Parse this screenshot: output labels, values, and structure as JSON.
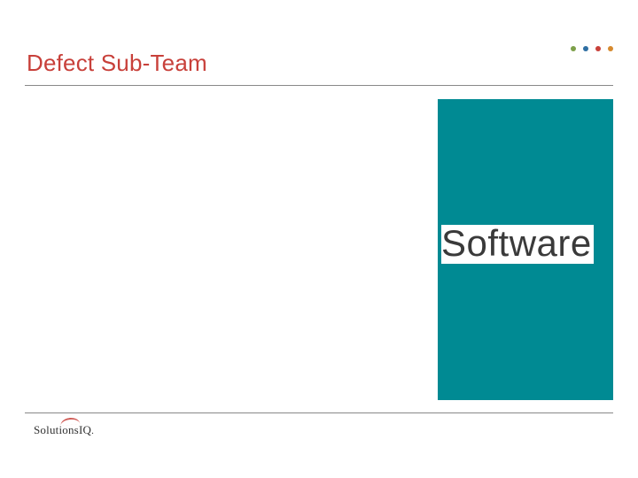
{
  "colors": {
    "title": "#c8403a",
    "teal": "#008a93",
    "dot1": "#7da04a",
    "dot2": "#2f6fa3",
    "dot3": "#c8403a",
    "dot4": "#d68a2f"
  },
  "header": {
    "title": "Defect Sub-Team"
  },
  "body": {
    "box_label": "Software"
  },
  "footer": {
    "logo_text_a": "Solutions",
    "logo_text_b": "IQ",
    "logo_suffix": "."
  }
}
